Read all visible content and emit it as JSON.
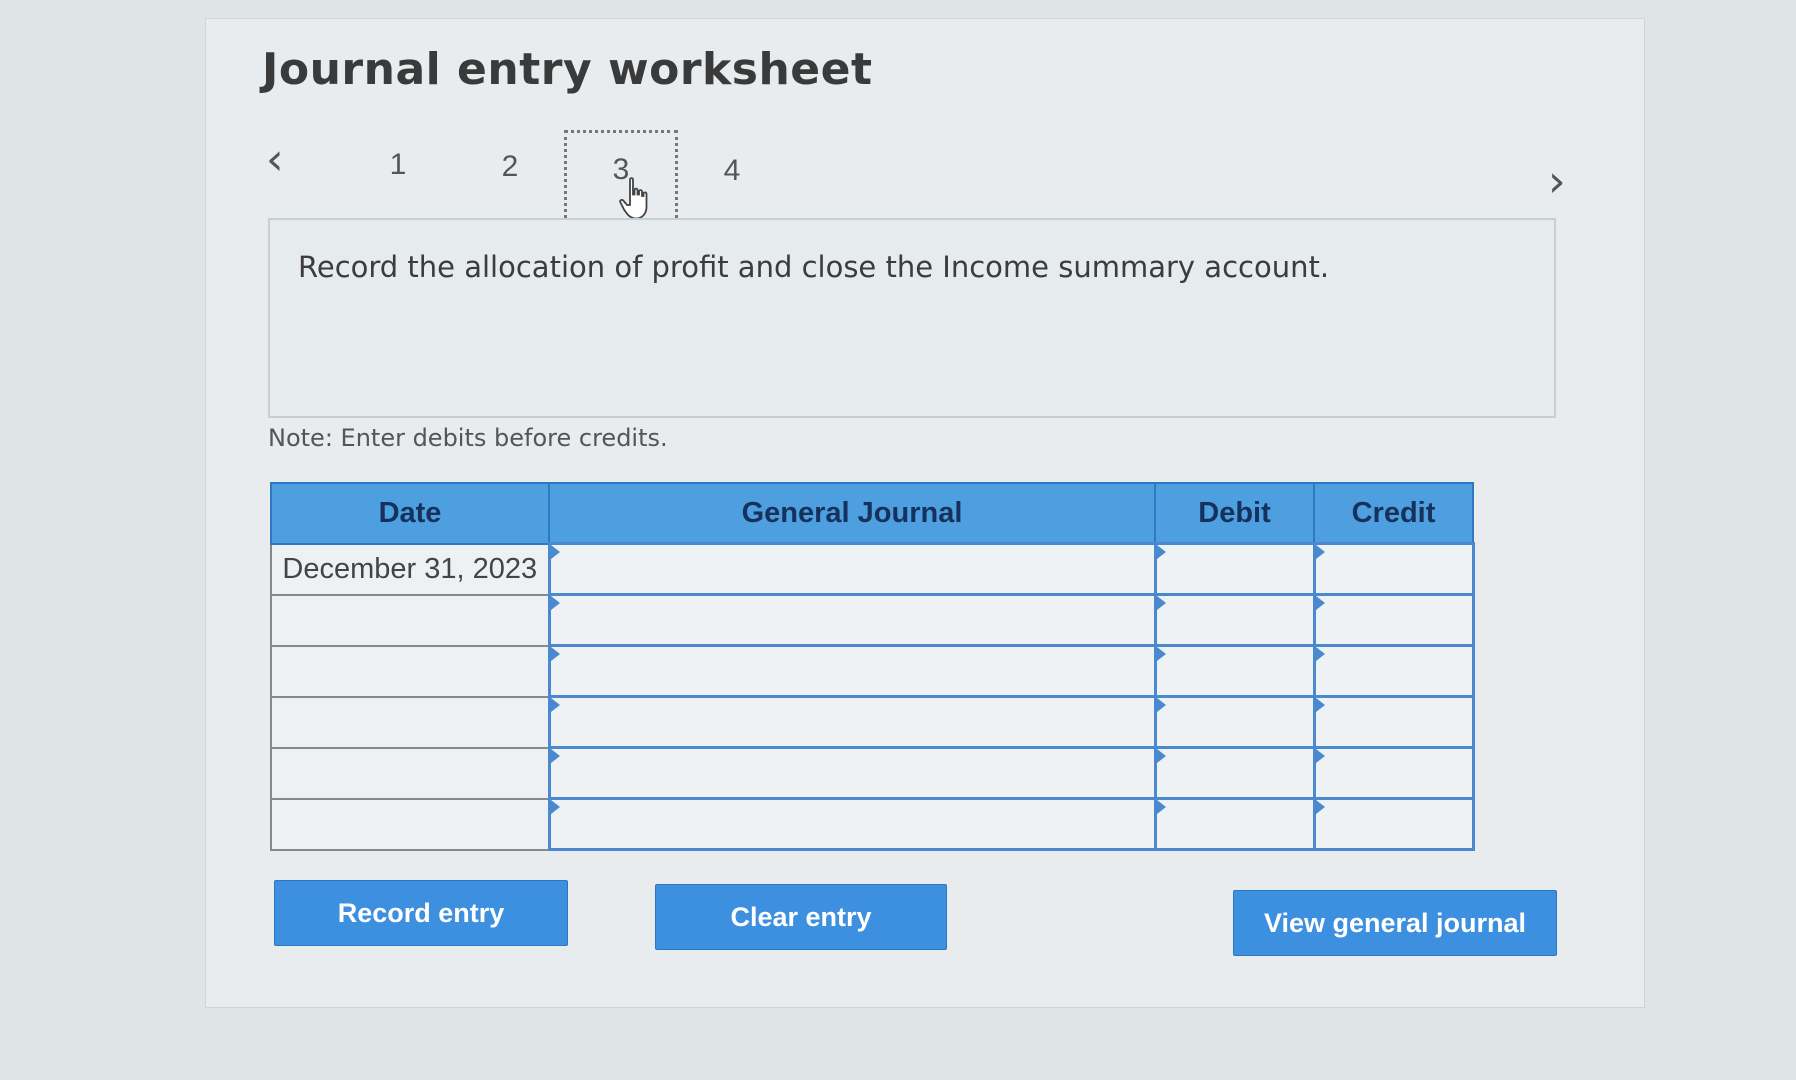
{
  "title": "Journal entry worksheet",
  "steps": {
    "prev_icon": "chevron-left-icon",
    "next_icon": "chevron-right-icon",
    "items": [
      "1",
      "2",
      "3",
      "4"
    ],
    "active": "3"
  },
  "instruction": "Record the allocation of profit and close the Income summary account.",
  "note": "Note: Enter debits before credits.",
  "table": {
    "headers": [
      "Date",
      "General Journal",
      "Debit",
      "Credit"
    ],
    "rows": [
      {
        "date": "December 31, 2023",
        "general_journal": "",
        "debit": "",
        "credit": ""
      },
      {
        "date": "",
        "general_journal": "",
        "debit": "",
        "credit": ""
      },
      {
        "date": "",
        "general_journal": "",
        "debit": "",
        "credit": ""
      },
      {
        "date": "",
        "general_journal": "",
        "debit": "",
        "credit": ""
      },
      {
        "date": "",
        "general_journal": "",
        "debit": "",
        "credit": ""
      },
      {
        "date": "",
        "general_journal": "",
        "debit": "",
        "credit": ""
      }
    ]
  },
  "buttons": {
    "record": "Record entry",
    "clear": "Clear entry",
    "view": "View general journal"
  },
  "colors": {
    "header_blue": "#4d9fe0",
    "button_blue": "#3d8fe0",
    "input_border": "#4a89d0"
  }
}
